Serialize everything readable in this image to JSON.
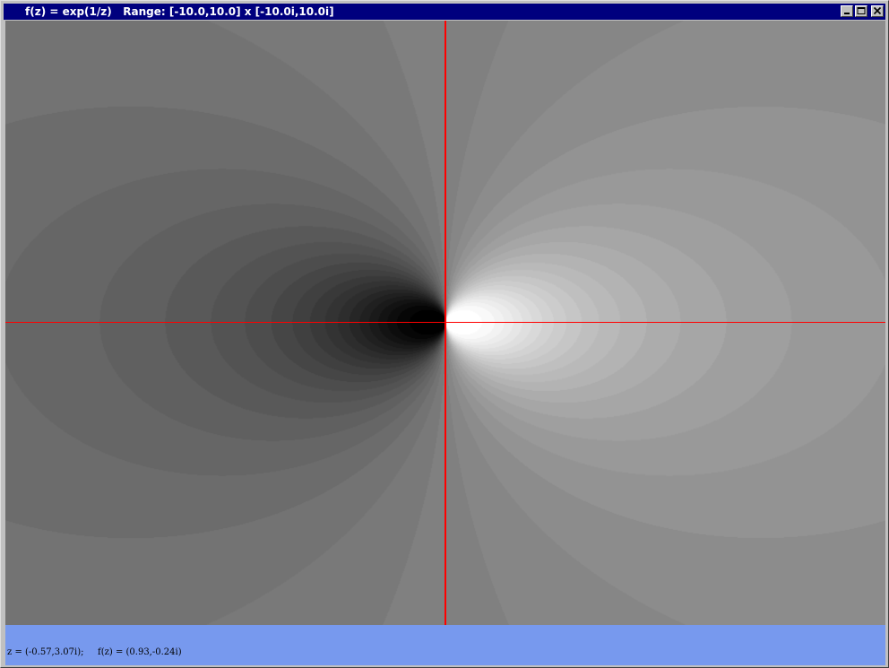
{
  "window": {
    "title": "f(z) = exp(1/z)   Range: [-10.0,10.0] x [-10.0i,10.0i]",
    "buttons": [
      "minimize",
      "maximize",
      "close"
    ]
  },
  "plot": {
    "function": "exp(1/z)",
    "x_range": [
      -10.0,
      10.0
    ],
    "y_range": [
      -10.0,
      10.0
    ],
    "axis_color": "#ff0000",
    "shading": "grayscale"
  },
  "status": {
    "z_text": "z = (-0.57,3.07i);",
    "fz_text": "f(z) = (0.93,-0.24i)",
    "background": "#7799ee"
  },
  "icons": {
    "app": "x-icon",
    "minimize": "minimize-icon",
    "maximize": "maximize-icon",
    "close": "close-icon"
  }
}
